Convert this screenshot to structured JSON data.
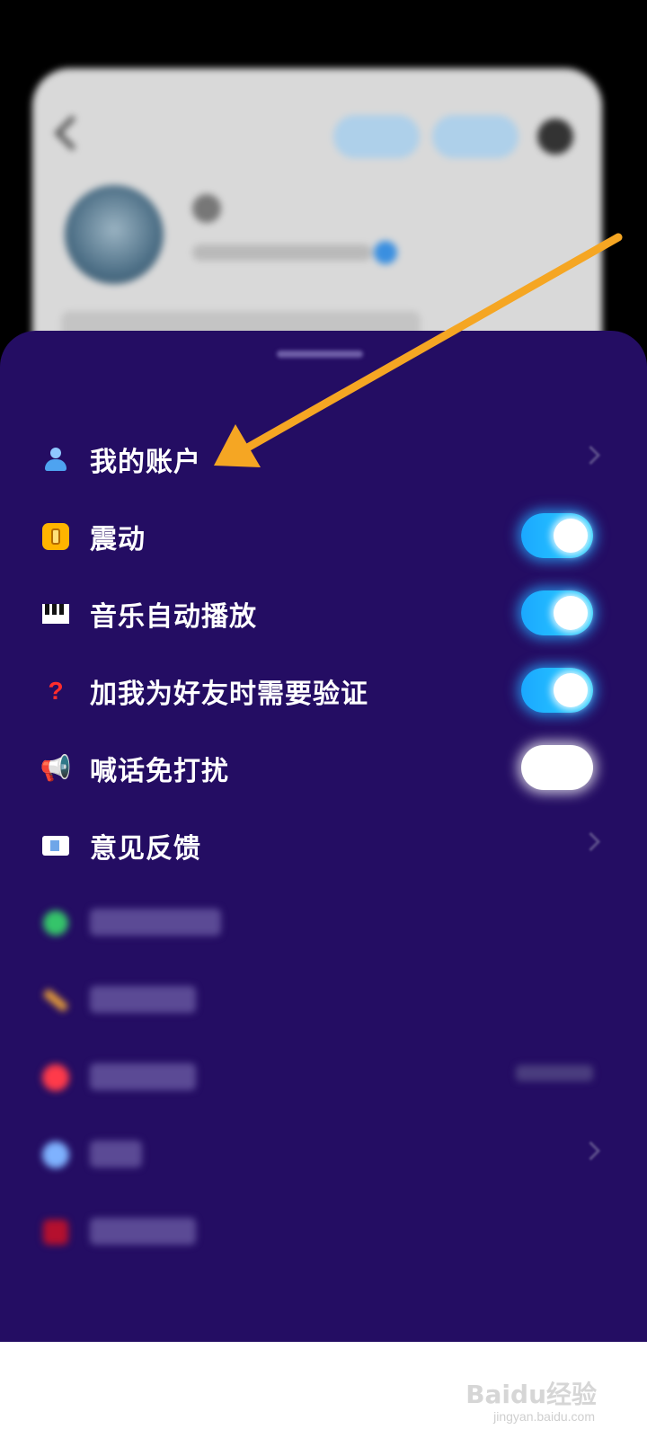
{
  "settings": {
    "items": [
      {
        "label": "我的账户",
        "icon": "user-icon",
        "control": "chevron"
      },
      {
        "label": "震动",
        "icon": "vibrate-icon",
        "control": "toggle",
        "toggle_on": true
      },
      {
        "label": "音乐自动播放",
        "icon": "piano-icon",
        "control": "toggle",
        "toggle_on": true
      },
      {
        "label": "加我为好友时需要验证",
        "icon": "question-icon",
        "control": "toggle",
        "toggle_on": true
      },
      {
        "label": "喊话免打扰",
        "icon": "megaphone-icon",
        "control": "toggle",
        "toggle_on": false
      },
      {
        "label": "意见反馈",
        "icon": "mail-icon",
        "control": "chevron"
      }
    ]
  },
  "watermark": {
    "brand": "Baidu经验",
    "url": "jingyan.baidu.com"
  },
  "colors": {
    "sheet_background": "#240d63",
    "toggle_on": "#1ba8ff",
    "arrow": "#f5a623"
  }
}
